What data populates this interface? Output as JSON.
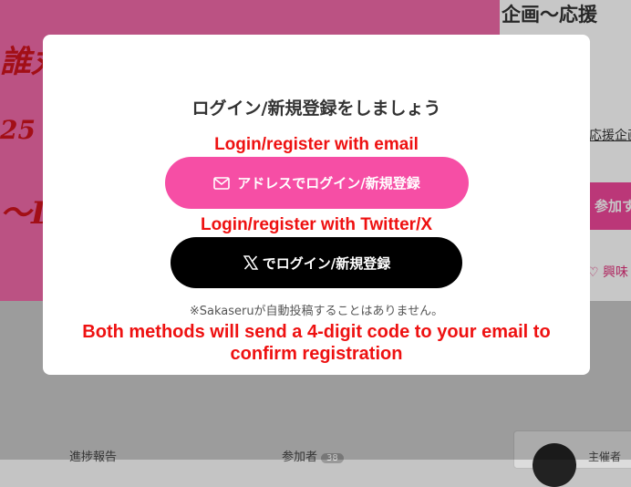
{
  "background": {
    "page_title": "企画〜応援",
    "hero_texts": [
      "誰丸",
      "25",
      "〜D"
    ],
    "support_link": "応援企画",
    "join_button": "参加す",
    "interest_label": "興味",
    "tabs": {
      "progress": "進捗報告",
      "participants": "参加者",
      "participants_count": "38",
      "organizer": "主催者"
    }
  },
  "modal": {
    "title": "ログイン/新規登録をしましょう",
    "annotation_email": "Login/register with email",
    "email_button": "アドレスでログイン/新規登録",
    "annotation_twitter": "Login/register with Twitter/X",
    "x_button": "でログイン/新規登録",
    "note": "※Sakaseruが自動投稿することはありません。",
    "annotation_code": "Both methods will send a 4-digit code to your email to confirm registration"
  },
  "colors": {
    "email_button": "#f64ea5",
    "x_button": "#000000",
    "annotation": "#ee1111",
    "hero": "#f06aa8"
  },
  "icons": {
    "email_button_icon": "mail-icon",
    "x_button_icon": "x-logo-icon"
  }
}
